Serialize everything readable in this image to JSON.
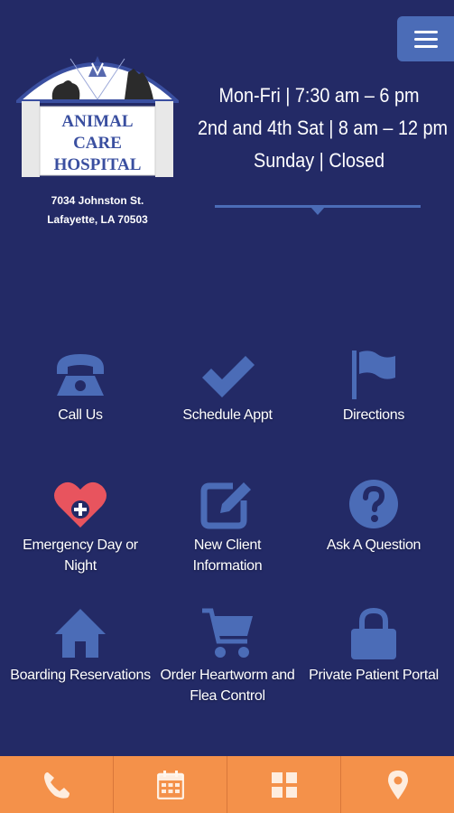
{
  "header": {
    "menu_icon": "hamburger-icon",
    "logo": {
      "line1": "ANIMAL",
      "line2": "CARE",
      "line3": "HOSPITAL"
    },
    "address_line1": "7034 Johnston St.",
    "address_line2": "Lafayette, LA 70503"
  },
  "hours": {
    "line1": "Mon-Fri | 7:30 am – 6 pm",
    "line2": "2nd and 4th Sat | 8 am – 12 pm",
    "line3": "Sunday | Closed"
  },
  "actions": [
    {
      "label": "Call Us",
      "icon": "phone-icon"
    },
    {
      "label": "Schedule Appt",
      "icon": "checkmark-icon"
    },
    {
      "label": "Directions",
      "icon": "flag-icon"
    },
    {
      "label1": "Emergency Day or",
      "label2": "Night",
      "icon": "heart-plus-icon"
    },
    {
      "label1": "New Client",
      "label2": "Information",
      "icon": "edit-icon"
    },
    {
      "label": "Ask A Question",
      "icon": "question-icon"
    },
    {
      "label": "Boarding Reservations",
      "icon": "home-icon"
    },
    {
      "label1": "Order Heartworm and",
      "label2": "Flea Control",
      "icon": "cart-icon"
    },
    {
      "label": "Private Patient Portal",
      "icon": "lock-icon"
    }
  ],
  "bottom_nav": [
    "phone-icon",
    "calendar-icon",
    "grid-icon",
    "map-pin-icon"
  ],
  "colors": {
    "background": "#232a66",
    "icon_blue": "#4b6cb7",
    "heart_red": "#e8545e",
    "bottom_bar": "#f4914a"
  }
}
